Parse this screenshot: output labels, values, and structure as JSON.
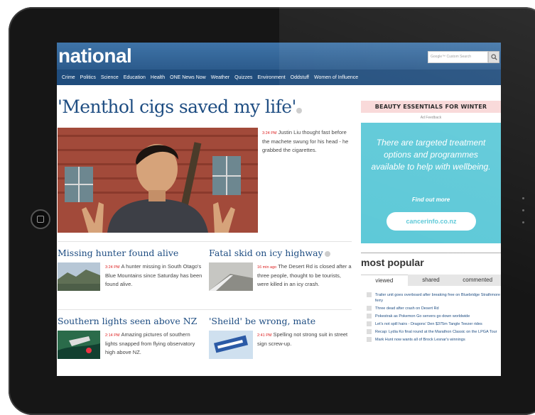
{
  "site": {
    "brand": "national",
    "search_placeholder": "Google™ Custom Search"
  },
  "nav": [
    "Crime",
    "Politics",
    "Science",
    "Education",
    "Health",
    "ONE News Now",
    "Weather",
    "Quizzes",
    "Environment",
    "Oddstuff",
    "Women of Influence"
  ],
  "lead": {
    "headline": "'Menthol cigs saved my life'",
    "time": "3:24 PM",
    "text": "Justin Liu thought fast before the machete swung for his head - he grabbed the cigarettes."
  },
  "stories": [
    {
      "title": "Missing hunter found alive",
      "time": "3:24 PM",
      "text": "A hunter missing in South Otago's Blue Mountains since Saturday has been found alive."
    },
    {
      "title": "Fatal skid on icy highway",
      "time": "16 min ago",
      "text": "The Desert Rd is closed after a three people, thought to be tourists, were killed in an icy crash."
    },
    {
      "title": "Southern lights seen above NZ",
      "time": "2:14 PM",
      "text": "Amazing pictures of southern lights snapped from flying observatory high above NZ."
    },
    {
      "title": "'Sheild' be wrong, mate",
      "time": "2:41 PM",
      "text": "Spelling not strong suit in street sign screw-up."
    }
  ],
  "ad": {
    "heading": "BEAUTY ESSENTIALS FOR WINTER",
    "feedback": "Ad Feedback",
    "message": "There are targeted treatment options and programmes available to help with wellbeing.",
    "find": "Find out more",
    "button": "cancerinfo.co.nz",
    "color": "#5ec9d8"
  },
  "most_popular": {
    "title": "most popular",
    "tabs": [
      "viewed",
      "shared",
      "commented"
    ],
    "items": [
      "Trailer unit goes overboard after breaking free on Bluebridge Strathmore ferry",
      "Three dead after crash on Desert Rd",
      "Pokestrak as Pokemon Go servers go down worldwide",
      "Let's not spill hairs - Dragons' Den $375m Tangle Teezer rides",
      "Recap: Lydia Ko final round at the Marathon Classic on the LPGA Tour",
      "Mark Hunt now wants all of Brock Lesnar's winnings"
    ]
  }
}
